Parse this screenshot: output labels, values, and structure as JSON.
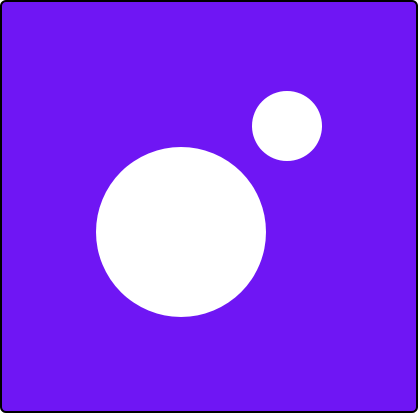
{
  "icon": {
    "name": "app-logo-icon",
    "background_color": "#6f16f4",
    "border_color": "#000000",
    "dot_color": "#ffffff"
  }
}
